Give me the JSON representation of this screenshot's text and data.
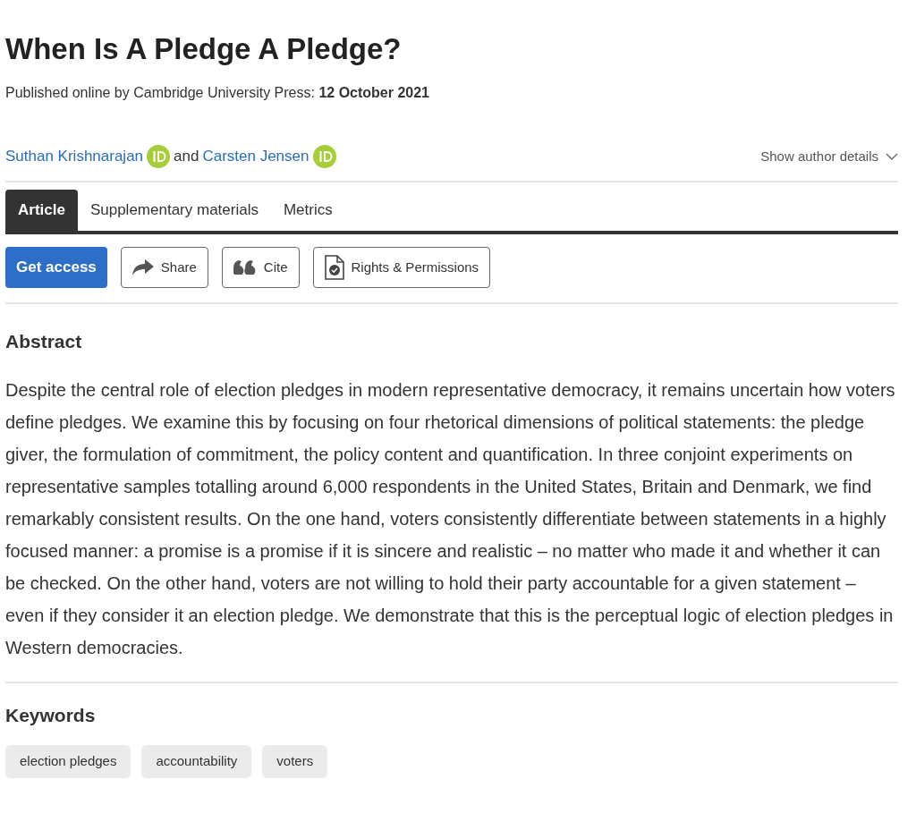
{
  "title": "When Is A Pledge A Pledge?",
  "published": "Published online by Cambridge University Press:  **12 October 2021**",
  "authors": [
    {
      "name": "Suthan Krishnarajan",
      "orcid": true
    },
    {
      "name": "Carsten Jensen",
      "orcid": true
    }
  ],
  "authors_joiner": "and",
  "author_details": "Show author details",
  "tabs": [
    {
      "label": "Article",
      "selected": true
    },
    {
      "label": "Supplementary materials",
      "selected": false
    },
    {
      "label": "Metrics",
      "selected": false
    }
  ],
  "actions": [
    {
      "label": "Get access",
      "kind": "primary"
    },
    {
      "label": "Share",
      "kind": "share"
    },
    {
      "label": "Cite",
      "kind": "cite"
    },
    {
      "label": "Rights & Permissions",
      "kind": "rights"
    }
  ],
  "abstract": {
    "heading": "Abstract",
    "text": "Despite the central role of election pledges in modern representative democracy, it remains uncertain how voters define pledges. We examine this by focusing on four rhetorical dimensions of political statements: the pledge giver, the formulation of commitment, the policy content and quantification. In three conjoint experiments on representative samples totalling around 6,000 respondents in the United States, Britain and Denmark, we find remarkably consistent results. On the one hand, voters consistently differentiate between statements in a highly focused manner: a promise is a promise if it is sincere and realistic – no matter who made it and whether it can be checked. On the other hand, voters are not willing to hold their party accountable for a given statement – even if they consider it an election pledge. We demonstrate that this is the perceptual logic of election pledges in Western democracies."
  },
  "keywords": {
    "heading": "Keywords",
    "items": [
      "election pledges",
      "accountability",
      "voters"
    ]
  }
}
